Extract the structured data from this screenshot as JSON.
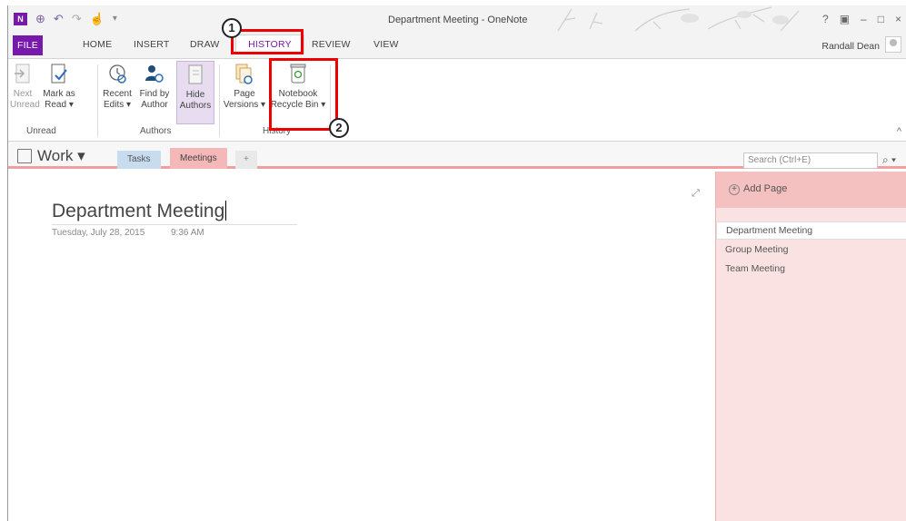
{
  "window": {
    "title": "Department Meeting - OneNote",
    "user_name": "Randall Dean",
    "help": "?",
    "minimize": "–",
    "maximize": "□",
    "close": "×"
  },
  "qat": {
    "logo": "N",
    "back": "⊕",
    "undo": "↶",
    "redo": "↷",
    "touch": "☝",
    "more": "▾"
  },
  "tabs": {
    "file": "FILE",
    "home": "HOME",
    "insert": "INSERT",
    "draw": "DRAW",
    "history": "HISTORY",
    "review": "REVIEW",
    "view": "VIEW"
  },
  "ribbon": {
    "next_unread": [
      "Next",
      "Unread"
    ],
    "mark_as_read": [
      "Mark as",
      "Read ▾"
    ],
    "recent_edits": [
      "Recent",
      "Edits ▾"
    ],
    "find_by_author": [
      "Find by",
      "Author"
    ],
    "hide_authors": [
      "Hide",
      "Authors"
    ],
    "page_versions": [
      "Page",
      "Versions ▾"
    ],
    "notebook_recycle_bin": [
      "Notebook",
      "Recycle Bin ▾"
    ],
    "groups": {
      "unread": "Unread",
      "authors": "Authors",
      "history": "History"
    },
    "collapse": "^"
  },
  "notebook": {
    "name": "Work ▾",
    "sections": [
      "Tasks",
      "Meetings",
      "+"
    ],
    "search_placeholder": "Search (Ctrl+E)",
    "search_icon": "⌕ ▾"
  },
  "page": {
    "title": "Department Meeting",
    "date": "Tuesday, July 28, 2015",
    "time": "9:36 AM",
    "expand_icon": "⤢"
  },
  "pagelist": {
    "add_page": "Add Page",
    "pages": [
      "Department Meeting",
      "Group Meeting",
      "Team Meeting"
    ]
  },
  "callouts": [
    "1",
    "2"
  ],
  "colors": {
    "onenote_purple": "#7719aa",
    "callout_red": "#e00000",
    "meetings_section": "#f4b8b8",
    "tasks_section": "#c8dcf0"
  }
}
